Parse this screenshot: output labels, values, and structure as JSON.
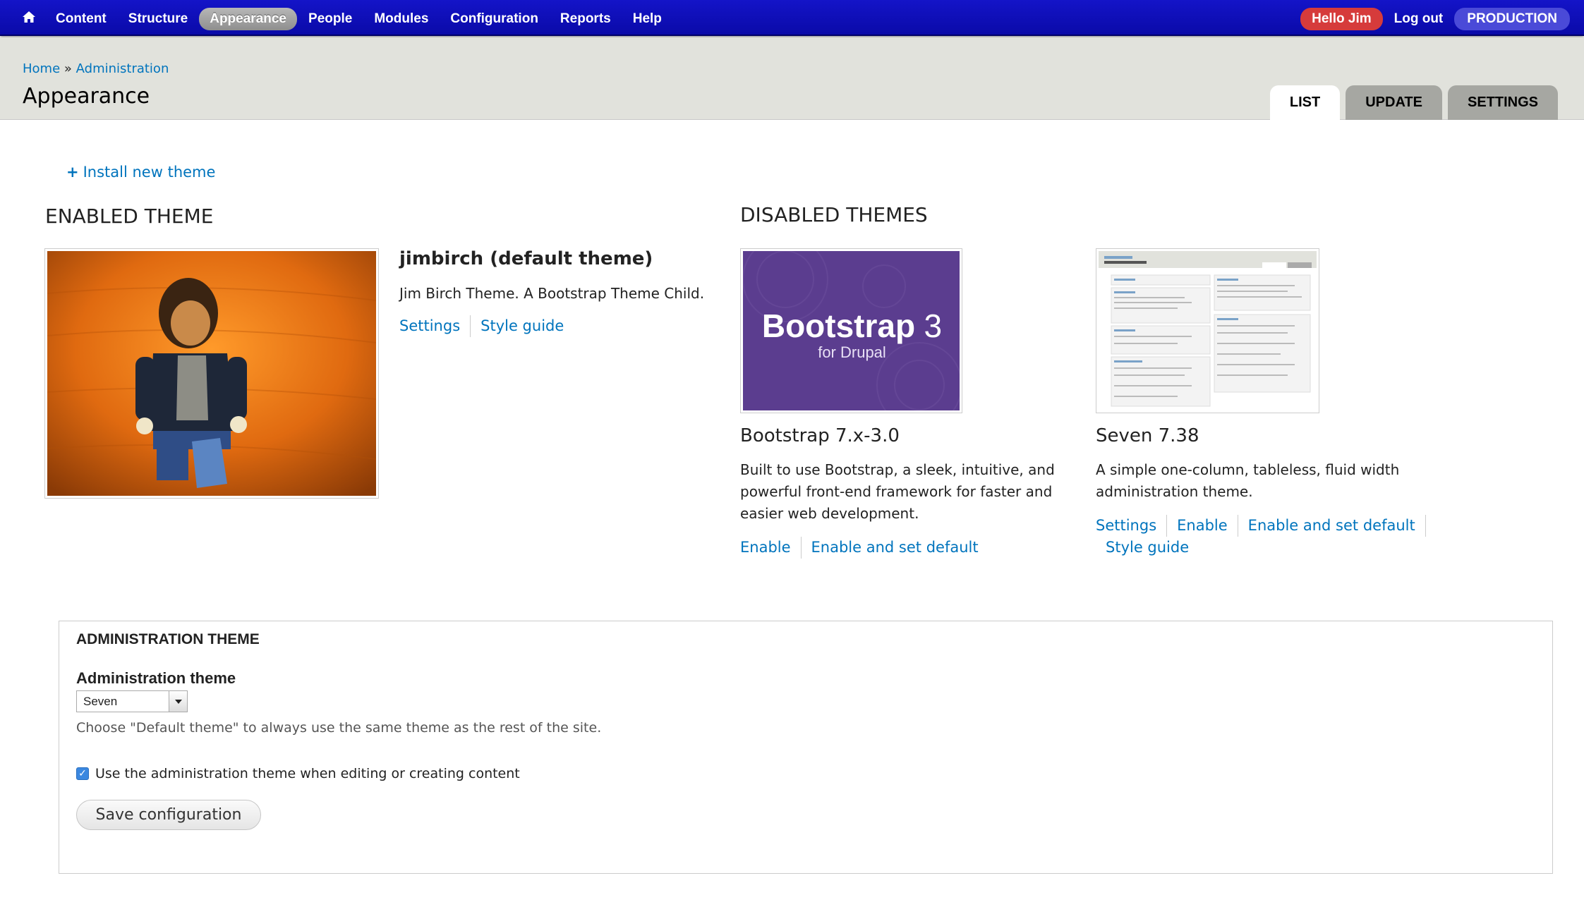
{
  "toolbar": {
    "home_icon": "home-icon",
    "menu": [
      {
        "label": "Content"
      },
      {
        "label": "Structure"
      },
      {
        "label": "Appearance",
        "active": true
      },
      {
        "label": "People"
      },
      {
        "label": "Modules"
      },
      {
        "label": "Configuration"
      },
      {
        "label": "Reports"
      },
      {
        "label": "Help"
      }
    ],
    "hello": "Hello Jim",
    "logout": "Log out",
    "environment": "PRODUCTION",
    "colors": {
      "bar": "#1414c8",
      "hello_badge": "#d63b3b",
      "env_badge": "#4a4ad8"
    }
  },
  "header": {
    "breadcrumb": {
      "home": "Home",
      "separator": "»",
      "admin": "Administration"
    },
    "title": "Appearance",
    "tabs": [
      {
        "label": "LIST",
        "active": true
      },
      {
        "label": "UPDATE"
      },
      {
        "label": "SETTINGS"
      }
    ]
  },
  "main": {
    "install_link": "Install new theme",
    "install_icon": "+",
    "enabled_heading": "ENABLED THEME",
    "disabled_heading": "DISABLED THEMES",
    "enabled_theme": {
      "name": "jimbirch (default theme)",
      "description": "Jim Birch Theme. A Bootstrap Theme Child.",
      "links": [
        "Settings",
        "Style guide"
      ]
    },
    "disabled_themes": [
      {
        "name": "Bootstrap 7.x-3.0",
        "description": "Built to use Bootstrap, a sleek, intuitive, and powerful front-end framework for faster and easier web development.",
        "logo_main": "Bootstrap",
        "logo_number": "3",
        "logo_sub": "for Drupal",
        "links": [
          "Enable",
          "Enable and set default"
        ]
      },
      {
        "name": "Seven 7.38",
        "description": "A simple one-column, tableless, fluid width administration theme.",
        "links": [
          "Settings",
          "Enable",
          "Enable and set default",
          "Style guide"
        ]
      }
    ]
  },
  "admin_theme": {
    "legend": "ADMINISTRATION THEME",
    "label": "Administration theme",
    "selected": "Seven",
    "help": "Choose \"Default theme\" to always use the same theme as the rest of the site.",
    "checkbox_label": "Use the administration theme when editing or creating content",
    "checkbox_checked": true,
    "save_label": "Save configuration"
  }
}
